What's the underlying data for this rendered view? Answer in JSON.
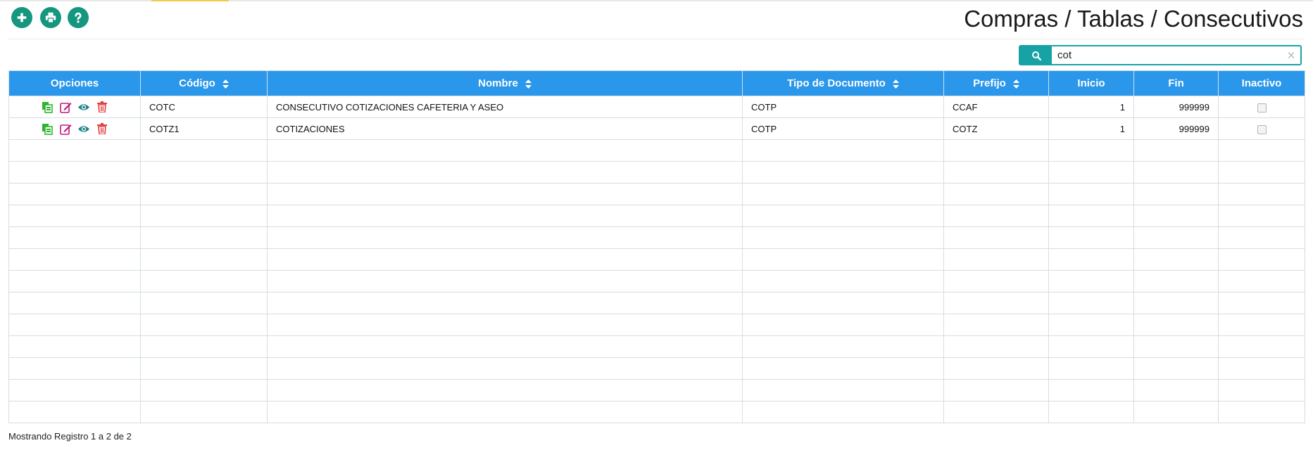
{
  "toolbar": {
    "add_icon": "plus-circle-icon",
    "print_icon": "print-icon",
    "help_icon": "question-circle-icon"
  },
  "breadcrumb": "Compras / Tablas / Consecutivos",
  "search": {
    "value": "cot",
    "icon": "search-icon",
    "clear_icon": "close-icon"
  },
  "table": {
    "columns": [
      {
        "label": "Opciones",
        "sortable": false
      },
      {
        "label": "Código",
        "sortable": true
      },
      {
        "label": "Nombre",
        "sortable": true
      },
      {
        "label": "Tipo de Documento",
        "sortable": true
      },
      {
        "label": "Prefijo",
        "sortable": true
      },
      {
        "label": "Inicio",
        "sortable": false
      },
      {
        "label": "Fin",
        "sortable": false
      },
      {
        "label": "Inactivo",
        "sortable": false
      }
    ],
    "rows": [
      {
        "codigo": "COTC",
        "nombre": "CONSECUTIVO COTIZACIONES CAFETERIA Y ASEO",
        "tipo": "COTP",
        "prefijo": "CCAF",
        "inicio": "1",
        "fin": "999999",
        "inactivo": false
      },
      {
        "codigo": "COTZ1",
        "nombre": "COTIZACIONES",
        "tipo": "COTP",
        "prefijo": "COTZ",
        "inicio": "1",
        "fin": "999999",
        "inactivo": false
      }
    ],
    "empty_rows": 13,
    "option_icons": [
      "copy-icon",
      "edit-icon",
      "view-icon",
      "delete-icon"
    ]
  },
  "footer": "Mostrando Registro 1 a 2 de 2",
  "colors": {
    "header_bg": "#2a97ea",
    "toolbar_btn": "#15967f",
    "search_accent": "#17a2a6",
    "copy_icon": "#2db52d",
    "edit_icon": "#c2187a",
    "view_icon": "#1a7f86",
    "delete_icon": "#e43b3b"
  }
}
